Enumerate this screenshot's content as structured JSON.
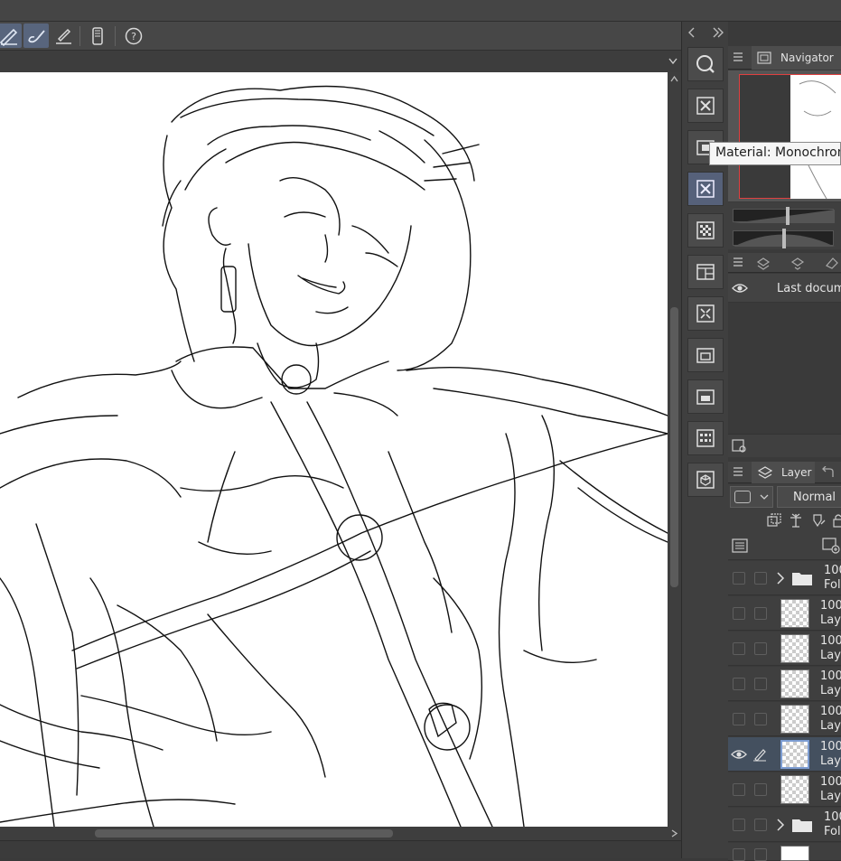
{
  "toolbar": {
    "icons": [
      "ruler-pen-icon",
      "brush-icon",
      "pen-line-icon",
      "phone-icon",
      "help-icon"
    ]
  },
  "navigator": {
    "tab_label": "Navigator"
  },
  "tooltip": {
    "text": "Material: Monochrom"
  },
  "history": {
    "item_label": "Last docume"
  },
  "layer_panel": {
    "tab_label": "Layer",
    "blend_mode": "Normal",
    "layers": [
      {
        "opacity": "100",
        "name": "Fol",
        "type": "folder",
        "visible": false,
        "selected": false
      },
      {
        "opacity": "100",
        "name": "Lay",
        "type": "raster",
        "visible": false,
        "selected": false
      },
      {
        "opacity": "100",
        "name": "Lay",
        "type": "raster",
        "visible": false,
        "selected": false
      },
      {
        "opacity": "100",
        "name": "Lay",
        "type": "raster",
        "visible": false,
        "selected": false
      },
      {
        "opacity": "100",
        "name": "Lay",
        "type": "raster",
        "visible": false,
        "selected": false
      },
      {
        "opacity": "100",
        "name": "Lay",
        "type": "raster",
        "visible": true,
        "selected": true
      },
      {
        "opacity": "100",
        "name": "Lay",
        "type": "raster",
        "visible": false,
        "selected": false
      },
      {
        "opacity": "100",
        "name": "Fol",
        "type": "folder",
        "visible": false,
        "selected": false
      }
    ]
  },
  "colors": {
    "panel_bg": "#3a3a3a",
    "selected_accent": "#56617a",
    "navigator_frame": "#e04040",
    "canvas": "#ffffff"
  }
}
